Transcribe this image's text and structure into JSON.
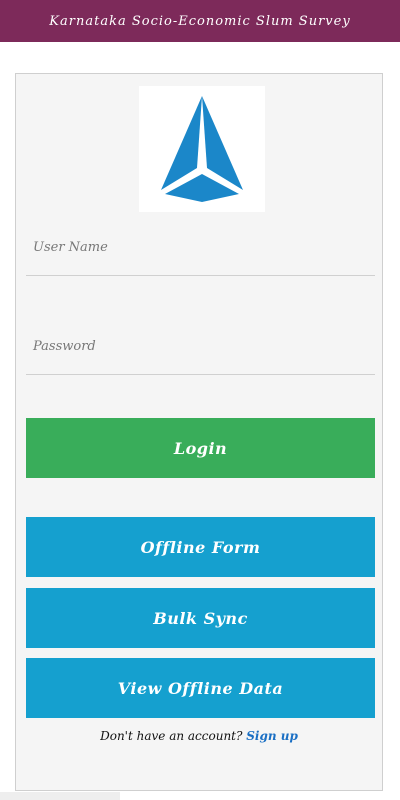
{
  "app_bar": {
    "title": "Karnataka Socio-Economic Slum Survey"
  },
  "colors": {
    "app_bar": "#7d2a5a",
    "login_button": "#39ad5a",
    "action_buttons": "#15a0cf",
    "logo": "#1b87c9",
    "signup_link": "#1a6fc4"
  },
  "logo": {
    "icon": "triangle-logo-icon"
  },
  "form": {
    "username_placeholder": "User Name",
    "password_placeholder": "Password"
  },
  "buttons": {
    "login": "Login",
    "offline_form": "Offline Form",
    "bulk_sync": "Bulk Sync",
    "view_offline_data": "View Offline Data"
  },
  "footer": {
    "prompt": "Don't have an account? ",
    "signup": "Sign up"
  }
}
